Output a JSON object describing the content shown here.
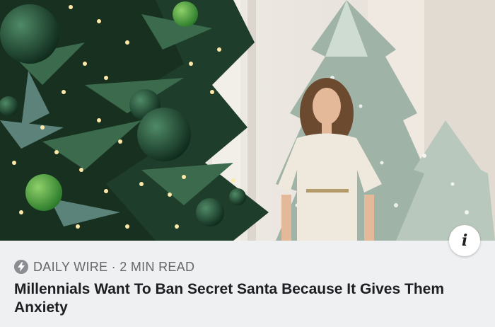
{
  "article": {
    "source": "DAILY WIRE",
    "separator": " · ",
    "read_time": "2 MIN READ",
    "headline": "Millennials Want To Ban Secret Santa Because It Gives Them Anxiety"
  },
  "hero_image": {
    "description_icon": "photo",
    "accent_colors": {
      "tree_green": "#1f3d2b",
      "ornament_green": "#2f7a3a",
      "dress": "#efe8dc",
      "wall": "#e9e4de"
    }
  },
  "info_button": {
    "icon": "info-icon",
    "glyph": "i"
  },
  "source_icon": "lightning-bolt-icon"
}
